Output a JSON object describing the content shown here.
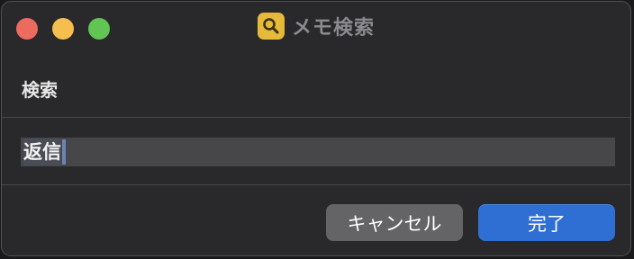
{
  "window": {
    "title": "メモ検索",
    "app_icon": "magnifying-glass-icon"
  },
  "traffic_lights": [
    {
      "name": "close",
      "color": "#ed6a5e"
    },
    {
      "name": "minimize",
      "color": "#f4bf4f"
    },
    {
      "name": "zoom",
      "color": "#61c554"
    }
  ],
  "search": {
    "label": "検索",
    "value": "返信"
  },
  "buttons": {
    "cancel_label": "キャンセル",
    "done_label": "完了"
  },
  "colors": {
    "accent": "#2f6fd3",
    "app_icon_bg": "#e5b93a"
  }
}
